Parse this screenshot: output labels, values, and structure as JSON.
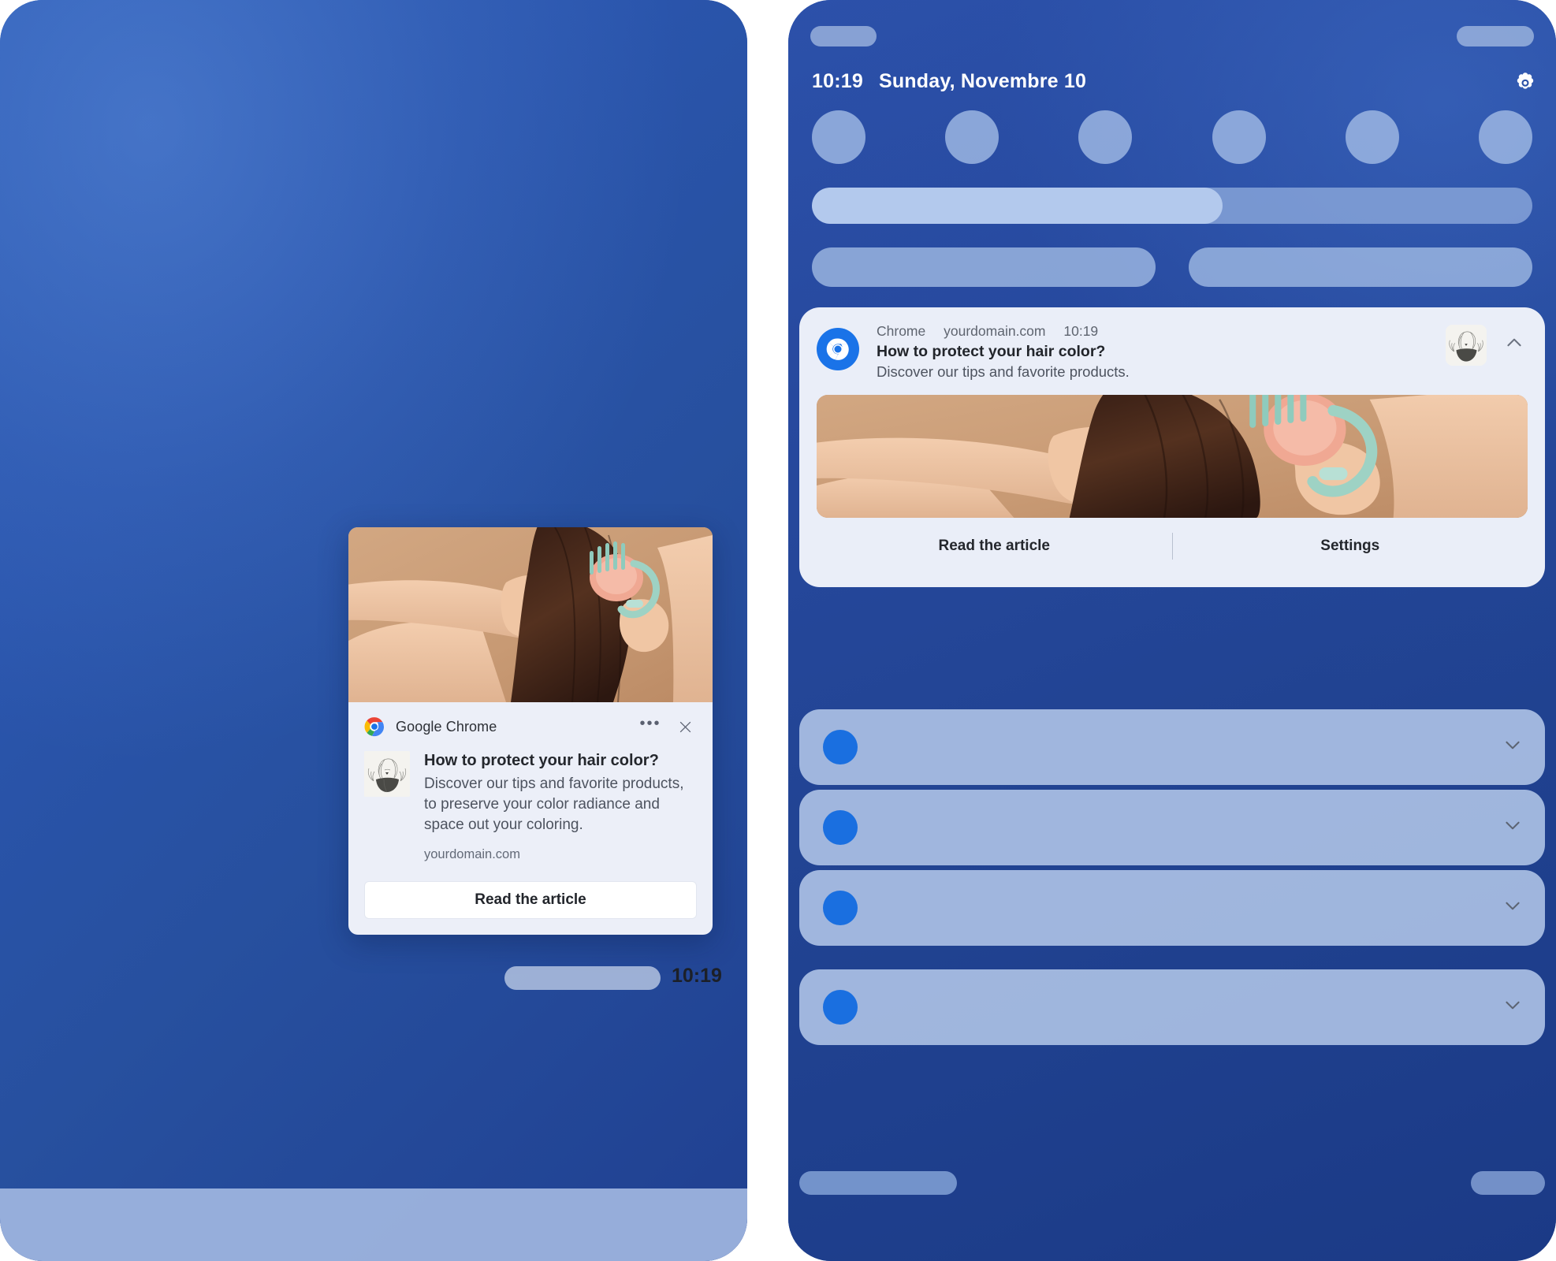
{
  "theme": {
    "desktop_wallpaper_blue": "#27509f",
    "phone_wallpaper_blue": "#21438f",
    "notification_surface": "#eaeef8",
    "chrome_blue": "#1a73e8",
    "accent_text_dark": "#24272d"
  },
  "desktop": {
    "toast": {
      "app_name": "Google Chrome",
      "app_icon": "chrome-icon",
      "more_icon": "ellipsis-icon",
      "close_icon": "close-icon",
      "thumbnail_icon": "woman-illustration-avatar",
      "hero_image_alt": "woman-brushing-hair-photo",
      "title": "How to protect your hair color?",
      "description": "Discover our tips and favorite products, to preserve your color radiance and space out your coloring.",
      "domain": "yourdomain.com",
      "cta_label": "Read the article"
    },
    "taskbar": {
      "clock": "10:19"
    }
  },
  "phone": {
    "status_bar": {
      "left_placeholder": "",
      "right_placeholder": ""
    },
    "header": {
      "time": "10:19",
      "date": "Sunday, Novembre 10",
      "settings_icon": "gear-icon"
    },
    "quick_settings": {
      "toggle_count": 6,
      "brightness_slider_percent": 57,
      "pill_count": 2
    },
    "notification": {
      "app_name": "Chrome",
      "app_icon": "chrome-icon",
      "domain": "yourdomain.com",
      "time": "10:19",
      "title": "How to protect your hair color?",
      "description": "Discover our tips and favorite products.",
      "thumbnail_icon": "woman-illustration-avatar",
      "hero_image_alt": "woman-brushing-hair-photo",
      "collapse_icon": "chevron-up-icon",
      "actions": [
        {
          "label": "Read the article",
          "name": "read-the-article-action"
        },
        {
          "label": "Settings",
          "name": "settings-action"
        }
      ]
    },
    "collapsed_notifications": [
      {
        "chevron_icon": "chevron-down-icon"
      },
      {
        "chevron_icon": "chevron-down-icon"
      },
      {
        "chevron_icon": "chevron-down-icon"
      },
      {
        "chevron_icon": "chevron-down-icon"
      }
    ]
  }
}
